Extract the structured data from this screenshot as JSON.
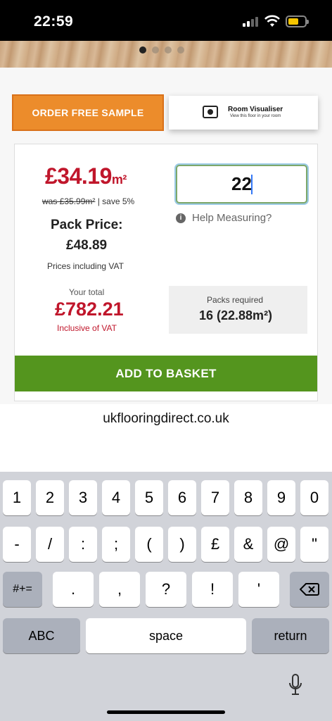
{
  "status": {
    "time": "22:59"
  },
  "carousel": {
    "slides": 4,
    "active": 0
  },
  "actions": {
    "sample_label": "ORDER FREE SAMPLE",
    "visualiser_title": "Room Visualiser",
    "visualiser_sub": "View this floor in your room"
  },
  "pricing": {
    "price": "£34.19",
    "unit": "m²",
    "was": "was £35.99m²",
    "save": " | save 5%",
    "pack_label": "Pack Price:",
    "pack_price": "£48.89",
    "vat_note": "Prices including VAT",
    "total_label": "Your total",
    "total": "£782.21",
    "total_vat": "Inclusive of VAT"
  },
  "quantity": {
    "value": "22",
    "help": "Help Measuring?"
  },
  "packs": {
    "label": "Packs required",
    "value": "16 (22.88m²)"
  },
  "basket_label": "ADD TO BASKET",
  "browser": {
    "url": "ukflooringdirect.co.uk"
  },
  "keyboard": {
    "row1": [
      "1",
      "2",
      "3",
      "4",
      "5",
      "6",
      "7",
      "8",
      "9",
      "0"
    ],
    "row2": [
      "-",
      "/",
      ":",
      ";",
      "(",
      ")",
      "£",
      "&",
      "@",
      "\""
    ],
    "row3": [
      ".",
      ",",
      "?",
      "!",
      "'"
    ],
    "symbols": "#+=",
    "abc": "ABC",
    "space": "space",
    "return": "return"
  }
}
